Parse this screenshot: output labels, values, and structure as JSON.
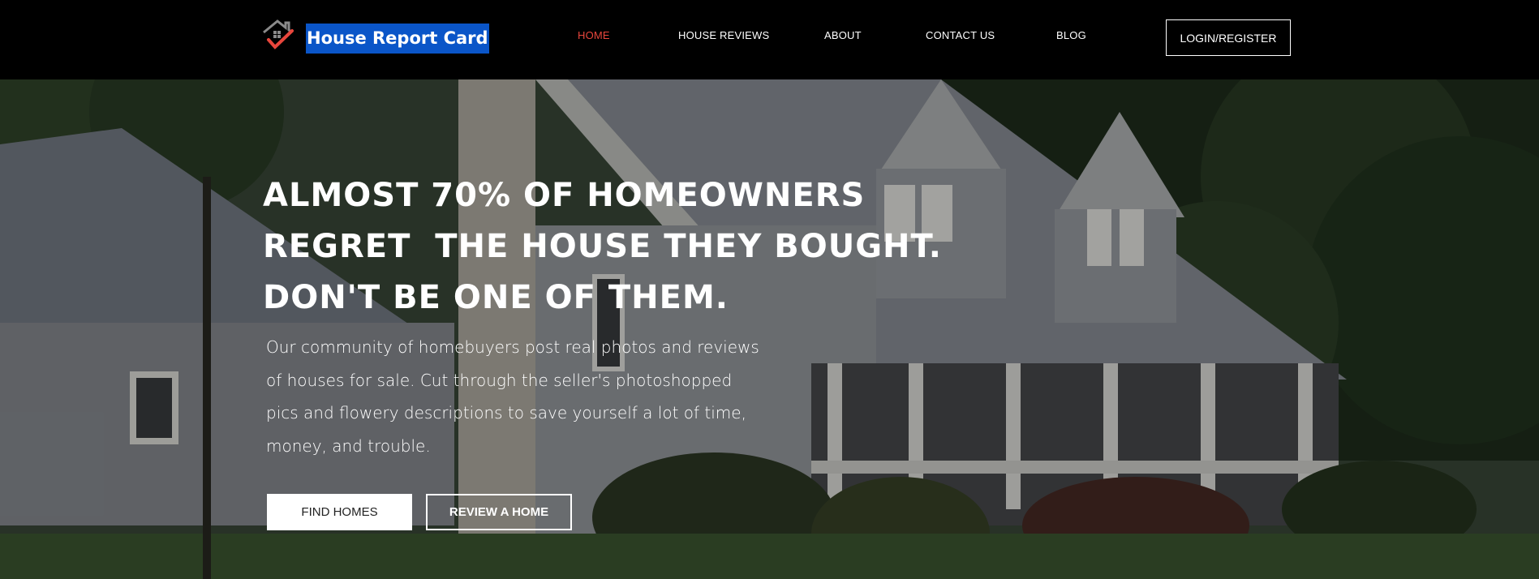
{
  "header": {
    "brand_name": "House Report Card",
    "logo_icon": "house-check-icon",
    "nav": [
      {
        "label": "HOME",
        "active": true
      },
      {
        "label": "HOUSE REVIEWS"
      },
      {
        "label": "ABOUT"
      },
      {
        "label": "CONTACT US"
      },
      {
        "label": "BLOG"
      }
    ],
    "login_label": "LOGIN/REGISTER"
  },
  "hero": {
    "headline_lines": [
      "ALMOST 70% OF HOMEOWNERS",
      "REGRET  THE HOUSE THEY BOUGHT.",
      "DON'T BE ONE OF THEM."
    ],
    "description": "Our community of homebuyers post real photos and reviews of houses for sale. Cut through the seller's photoshopped pics and flowery descriptions to save yourself a lot of time, money, and trouble.",
    "find_homes_label": "FIND HOMES",
    "review_home_label": "REVIEW A HOME",
    "background": "craftsman-house-photo"
  },
  "colors": {
    "header_bg": "#000000",
    "brand_highlight": "#0a55c8",
    "active_nav": "#e8463c",
    "text": "#ffffff"
  }
}
